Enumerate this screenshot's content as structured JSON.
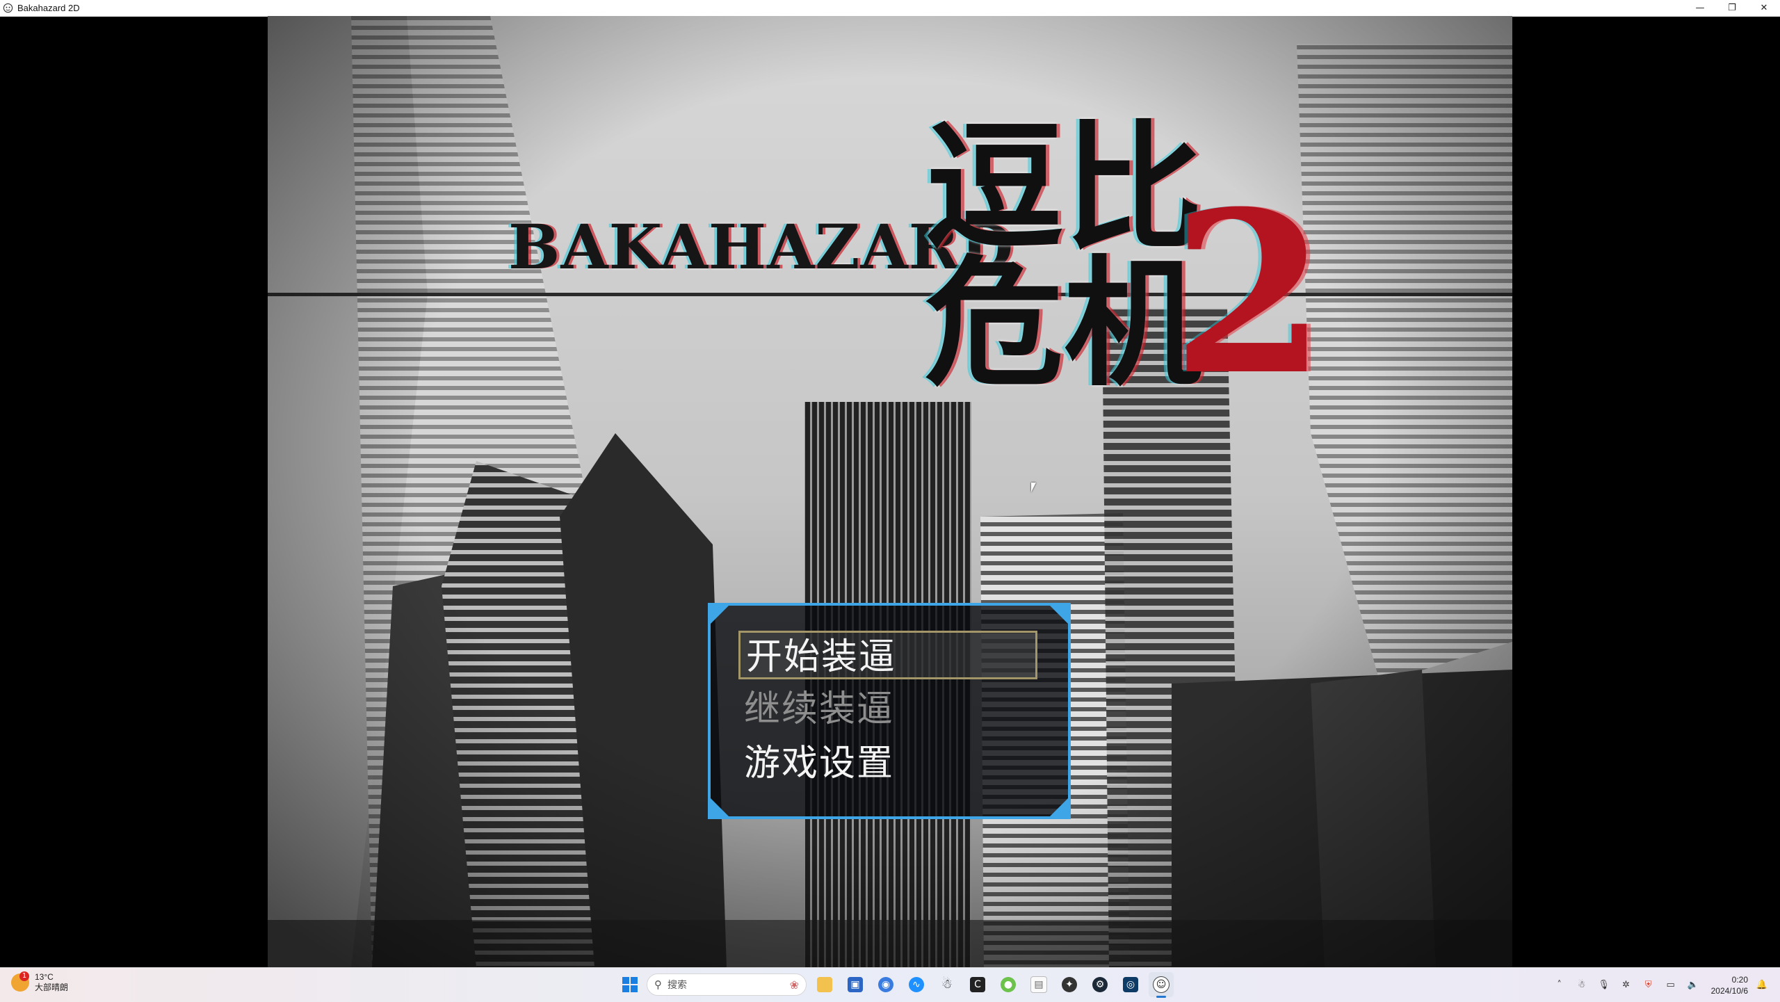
{
  "window": {
    "title": "Bakahazard 2D",
    "controls": {
      "minimize": "—",
      "restore": "❐",
      "close": "✕"
    }
  },
  "game": {
    "logo_english": "BAKAHAZARD",
    "logo_chinese": "逗比危机",
    "logo_number": "2",
    "menu": [
      {
        "label": "开始装逼",
        "state": "selected"
      },
      {
        "label": "继续装逼",
        "state": "disabled"
      },
      {
        "label": "游戏设置",
        "state": "enabled"
      }
    ],
    "colors": {
      "menu_border": "#3ea6e6",
      "logo_red": "#b31420",
      "selection_border": "#a3976a"
    }
  },
  "taskbar": {
    "weather": {
      "badge": "1",
      "temperature": "13°C",
      "condition": "大部晴朗"
    },
    "search_placeholder": "搜索",
    "apps": [
      "file-explorer-icon",
      "store-icon",
      "browser-icon",
      "app-icon",
      "qq-icon",
      "app-c-icon",
      "app-green-icon",
      "file-icon",
      "app-dark-icon",
      "steam-icon",
      "app-blue-icon",
      "bakahazard-icon"
    ],
    "clock": {
      "time": "0:20",
      "date": "2024/10/6"
    }
  }
}
